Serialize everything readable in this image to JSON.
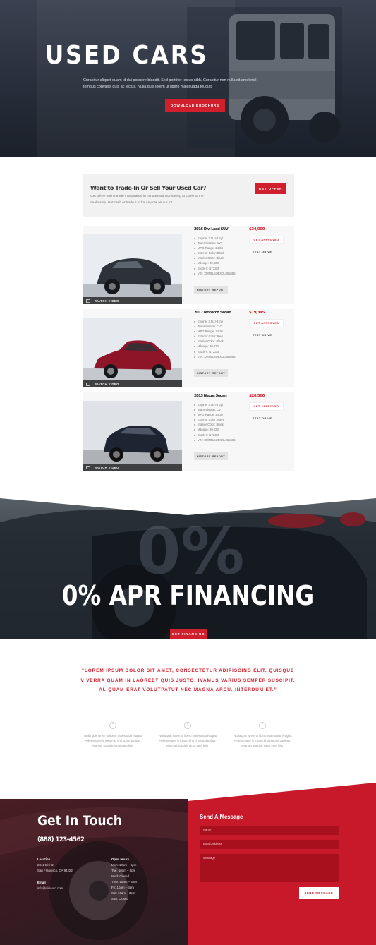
{
  "hero": {
    "title": "USED CARS",
    "text": "Curabitur aliquet quam id dui posuere blandit. Sed porttitor lectus nibh. Curabitur non nulla sit amet nisl tempus convallis quis ac lectus. Nulla quis lorem ut libero malesuada feugiat.",
    "button": "DOWNLOAD BROCHURE"
  },
  "trade": {
    "title": "Want to Trade-In Or Sell Your Used Car?",
    "text": "Get a free online trade in appraisal in minutes without having to come to the dealership. Get cash or trade it in for any car on our lot.",
    "button": "GET OFFER"
  },
  "listings": [
    {
      "title": "2016 Divi Lead SUV",
      "price": "$34,000",
      "specs": [
        "Engine: 3.5L I-4 cyl",
        "Transmission: CVT",
        "MPG Range: 24/36",
        "Exterior Color: Black",
        "Interior Color: Black",
        "Mileage: 30,023",
        "Stock #: NT2335",
        "VIN: XMN5L5UEXDL059485"
      ],
      "history": "HISTORY REPORT",
      "approved": "GET APPROVED",
      "test": "TEST DRIVE",
      "watch": "WATCH VIDEO"
    },
    {
      "title": "2017 Monarch Sedan",
      "price": "$19,345",
      "specs": [
        "Engine: 3.5L I-4 cyl",
        "Transmission: CVT",
        "MPG Range: 24/36",
        "Exterior Color: Red",
        "Interior Color: Black",
        "Mileage: 30,023",
        "Stock #: NT2335",
        "VIN: XMN5L5UEXDL059485"
      ],
      "history": "HISTORY REPORT",
      "approved": "GET APPROVED",
      "test": "TEST DRIVE",
      "watch": "WATCH VIDEO"
    },
    {
      "title": "2013 Nexus Sedan",
      "price": "$26,500",
      "specs": [
        "Engine: 3.5L I-4 cyl",
        "Transmission: CVT",
        "MPG Range: 24/36",
        "Exterior Color: Navy",
        "Interior Color: Black",
        "Mileage: 30,023",
        "Stock #: NT2335",
        "VIN: XMN5L5UEXDL059485"
      ],
      "history": "HISTORY REPORT",
      "approved": "GET APPROVED",
      "test": "TEST DRIVE",
      "watch": "WATCH VIDEO"
    }
  ],
  "financing": {
    "title": "0% APR FINANCING",
    "watermark": "0%",
    "button": "GET FINANCING"
  },
  "quote": {
    "line1": "“LOREM IPSUM DOLOR SIT AMET, CONSECTETUR ADIPISCING ELIT. QUISQUE",
    "line2": "VIVERRA QUAM IN LAOREET QUIS JUSTO. IVAMUS VARIUS SEMPER SUSCIPIT.",
    "line3": "ALIQUAM ERAT VOLUTPATUT NEC MAGNA ARCU. INTERDUM ET.”"
  },
  "testimonials": [
    {
      "l1": "“Nulla quis lorem ut libero malesuada feugiat.",
      "l2": "Pellentesque in ipsum id orci porta dapibus.",
      "l3": "Vivamus suscipit tortor eget felis”"
    },
    {
      "l1": "“Nulla quis lorem ut libero malesuada feugiat.",
      "l2": "Pellentesque in ipsum id orci porta dapibus.",
      "l3": "Vivamus suscipit tortor eget felis”"
    },
    {
      "l1": "“Nulla quis lorem ut libero malesuada feugiat.",
      "l2": "Pellentesque in ipsum id orci porta dapibus.",
      "l3": "Vivamus suscipit tortor eget felis”"
    }
  ],
  "contact": {
    "title": "Get In Touch",
    "phone": "(888) 123-4562",
    "location_label": "Location",
    "address1": "2341 Divi St",
    "address2": "San Francisco, CA 94222",
    "email_label": "Email",
    "email": "info@diviauto.com",
    "hours_label": "Open Hours",
    "hours": [
      "Mon: 10am – 5pm",
      "Tue: 10am – 5pm",
      "Wed: Closed",
      "Thur: 10am – 5pm",
      "Fri: 10am – 3pm",
      "Sat: 10am – 3pm",
      "Sun: Closed"
    ]
  },
  "form": {
    "title": "Send A Message",
    "name_placeholder": "Name",
    "email_placeholder": "Email Address",
    "message_placeholder": "Message",
    "button": "SEND MESSAGE"
  },
  "colors": {
    "accent": "#d0202e",
    "dark": "#262c38"
  }
}
